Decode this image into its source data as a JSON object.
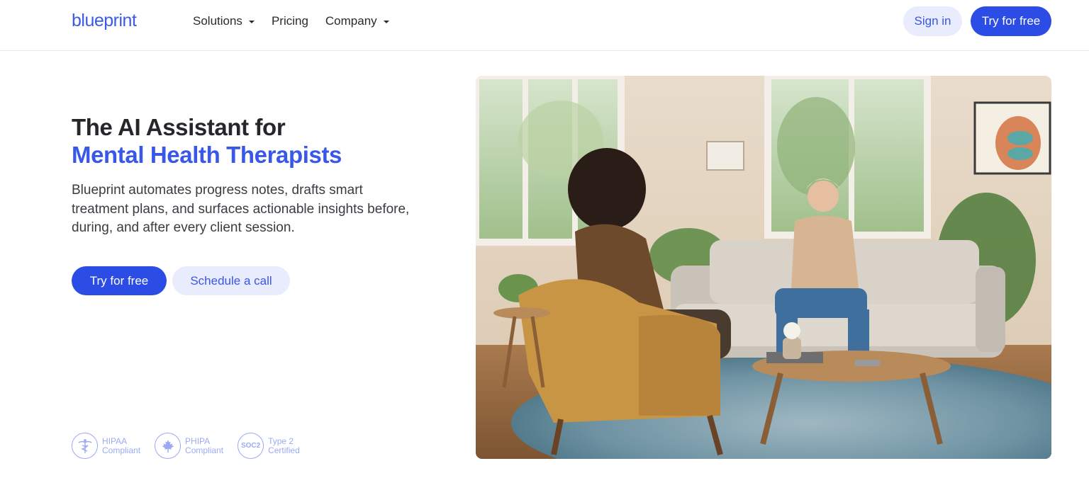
{
  "header": {
    "logo_text": "blueprint",
    "nav": [
      {
        "label": "Solutions",
        "has_dropdown": true
      },
      {
        "label": "Pricing",
        "has_dropdown": false
      },
      {
        "label": "Company",
        "has_dropdown": true
      }
    ],
    "sign_in_label": "Sign in",
    "try_label": "Try for free"
  },
  "hero": {
    "headline": "The AI Assistant for",
    "headline_accent": "Mental Health Therapists",
    "description": "Blueprint automates progress notes, drafts smart treatment plans, and surfaces actionable insights before, during, and after every client session.",
    "primary_cta": "Try for free",
    "secondary_cta": "Schedule a call"
  },
  "badges": [
    {
      "icon": "caduceus-icon",
      "line1": "HIPAA",
      "line2": "Compliant"
    },
    {
      "icon": "maple-leaf-icon",
      "line1": "PHIPA",
      "line2": "Compliant"
    },
    {
      "icon": "soc2-icon",
      "glyph": "SOC2",
      "line1": "Type 2",
      "line2": "Certified"
    }
  ],
  "colors": {
    "accent": "#2c4ce6",
    "accent_soft": "#e8ecfd",
    "heading": "#26262b",
    "heading_accent": "#3a58e8"
  },
  "photo": {
    "icon": "therapy-session-photo"
  }
}
